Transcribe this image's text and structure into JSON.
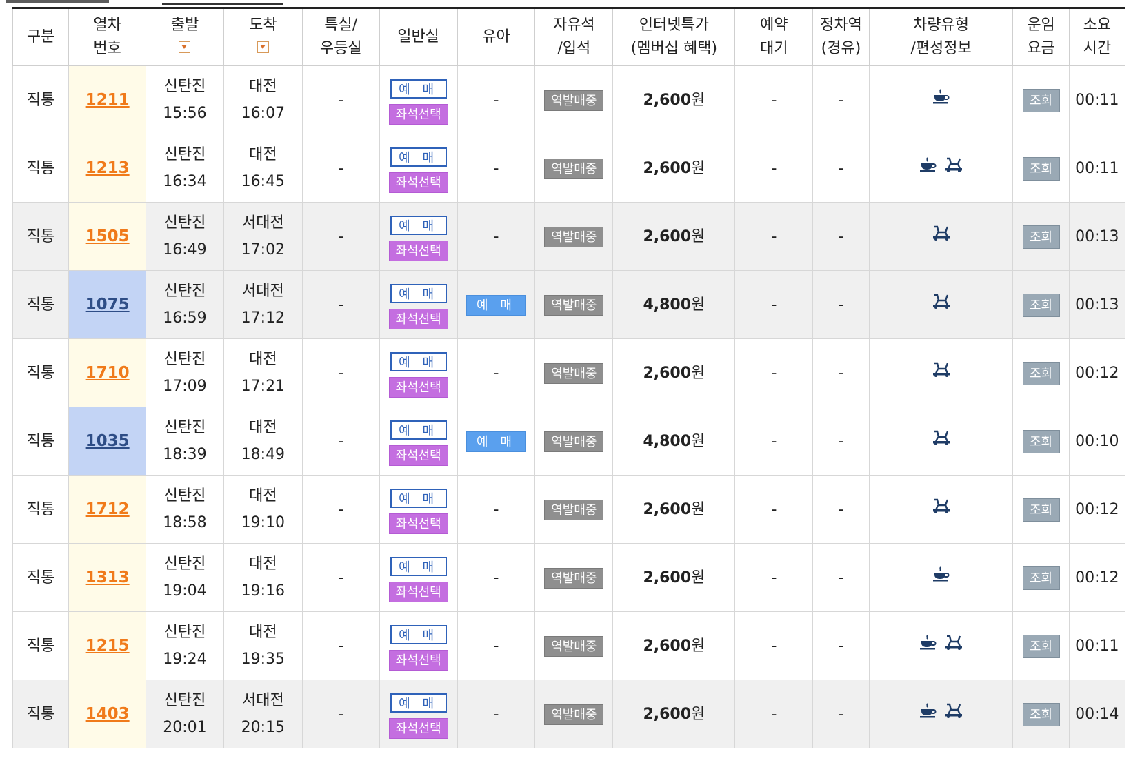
{
  "headers": {
    "type": [
      "구분"
    ],
    "train": [
      "열차",
      "번호"
    ],
    "depart": [
      "출발"
    ],
    "arrive": [
      "도착"
    ],
    "special": [
      "특실/",
      "우등실"
    ],
    "general": [
      "일반실"
    ],
    "infant": [
      "유아"
    ],
    "free": [
      "자유석",
      "/입석"
    ],
    "internet": [
      "인터넷특가",
      "(멤버십 혜택)"
    ],
    "waitlist": [
      "예약",
      "대기"
    ],
    "stops": [
      "정차역",
      "(경유)"
    ],
    "cartype": [
      "차량유형",
      "/편성정보"
    ],
    "fare": [
      "운임",
      "요금"
    ],
    "duration": [
      "소요",
      "시간"
    ]
  },
  "labels": {
    "book": "예 매",
    "seat_select": "좌석선택",
    "station_sale": "역발매중",
    "fare_view": "조회",
    "dash": "-",
    "won": "원"
  },
  "colors": {
    "train_normal": "#f07a1a",
    "train_ktx": "#2e4d86",
    "ktx_cell_bg": "#c3d4f5",
    "seat_button": "#c46ee0",
    "infant_button": "#5aa0ee"
  },
  "rows": [
    {
      "type": "직통",
      "train": "1211",
      "ktx": false,
      "alt": false,
      "dep_station": "신탄진",
      "dep_time": "15:56",
      "arr_station": "대전",
      "arr_time": "16:07",
      "special": "-",
      "infant": "-",
      "price": "2,600",
      "waitlist": "-",
      "stops": "-",
      "icons": [
        "cafe-icon"
      ],
      "duration": "00:11"
    },
    {
      "type": "직통",
      "train": "1213",
      "ktx": false,
      "alt": false,
      "dep_station": "신탄진",
      "dep_time": "16:34",
      "arr_station": "대전",
      "arr_time": "16:45",
      "special": "-",
      "infant": "-",
      "price": "2,600",
      "waitlist": "-",
      "stops": "-",
      "icons": [
        "cafe-icon",
        "bicycle-icon"
      ],
      "duration": "00:11"
    },
    {
      "type": "직통",
      "train": "1505",
      "ktx": false,
      "alt": true,
      "dep_station": "신탄진",
      "dep_time": "16:49",
      "arr_station": "서대전",
      "arr_time": "17:02",
      "special": "-",
      "infant": "-",
      "price": "2,600",
      "waitlist": "-",
      "stops": "-",
      "icons": [
        "bicycle-icon"
      ],
      "duration": "00:13"
    },
    {
      "type": "직통",
      "train": "1075",
      "ktx": true,
      "alt": true,
      "dep_station": "신탄진",
      "dep_time": "16:59",
      "arr_station": "서대전",
      "arr_time": "17:12",
      "special": "-",
      "infant": "book",
      "price": "4,800",
      "waitlist": "-",
      "stops": "-",
      "icons": [
        "bicycle-icon"
      ],
      "duration": "00:13"
    },
    {
      "type": "직통",
      "train": "1710",
      "ktx": false,
      "alt": false,
      "dep_station": "신탄진",
      "dep_time": "17:09",
      "arr_station": "대전",
      "arr_time": "17:21",
      "special": "-",
      "infant": "-",
      "price": "2,600",
      "waitlist": "-",
      "stops": "-",
      "icons": [
        "bicycle-icon"
      ],
      "duration": "00:12"
    },
    {
      "type": "직통",
      "train": "1035",
      "ktx": true,
      "alt": false,
      "dep_station": "신탄진",
      "dep_time": "18:39",
      "arr_station": "대전",
      "arr_time": "18:49",
      "special": "-",
      "infant": "book",
      "price": "4,800",
      "waitlist": "-",
      "stops": "-",
      "icons": [
        "bicycle-icon"
      ],
      "duration": "00:10"
    },
    {
      "type": "직통",
      "train": "1712",
      "ktx": false,
      "alt": false,
      "dep_station": "신탄진",
      "dep_time": "18:58",
      "arr_station": "대전",
      "arr_time": "19:10",
      "special": "-",
      "infant": "-",
      "price": "2,600",
      "waitlist": "-",
      "stops": "-",
      "icons": [
        "bicycle-icon"
      ],
      "duration": "00:12"
    },
    {
      "type": "직통",
      "train": "1313",
      "ktx": false,
      "alt": false,
      "dep_station": "신탄진",
      "dep_time": "19:04",
      "arr_station": "대전",
      "arr_time": "19:16",
      "special": "-",
      "infant": "-",
      "price": "2,600",
      "waitlist": "-",
      "stops": "-",
      "icons": [
        "cafe-icon"
      ],
      "duration": "00:12"
    },
    {
      "type": "직통",
      "train": "1215",
      "ktx": false,
      "alt": false,
      "dep_station": "신탄진",
      "dep_time": "19:24",
      "arr_station": "대전",
      "arr_time": "19:35",
      "special": "-",
      "infant": "-",
      "price": "2,600",
      "waitlist": "-",
      "stops": "-",
      "icons": [
        "cafe-icon",
        "bicycle-icon"
      ],
      "duration": "00:11"
    },
    {
      "type": "직통",
      "train": "1403",
      "ktx": false,
      "alt": true,
      "dep_station": "신탄진",
      "dep_time": "20:01",
      "arr_station": "서대전",
      "arr_time": "20:15",
      "special": "-",
      "infant": "-",
      "price": "2,600",
      "waitlist": "-",
      "stops": "-",
      "icons": [
        "cafe-icon",
        "bicycle-icon"
      ],
      "duration": "00:14"
    }
  ]
}
